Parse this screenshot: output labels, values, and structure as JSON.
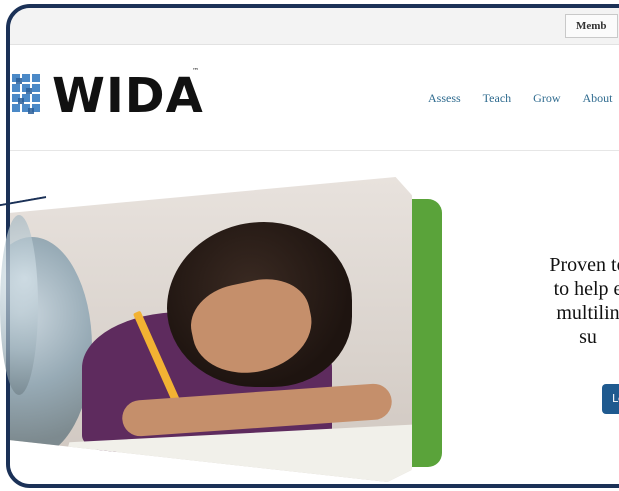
{
  "topbar": {
    "member_label": "Memb"
  },
  "brand": {
    "name": "WIDA",
    "trademark": "™",
    "accent_color": "#5aa33a",
    "blue_color": "#1b3157",
    "link_color": "#2f6b8f"
  },
  "nav": {
    "items": [
      "Assess",
      "Teach",
      "Grow",
      "About"
    ]
  },
  "hero": {
    "lines": [
      "Proven to",
      "to help e",
      "multilin",
      "su"
    ],
    "cta_label": "Lea"
  },
  "icons": {
    "logo": "wida-logo-icon"
  }
}
